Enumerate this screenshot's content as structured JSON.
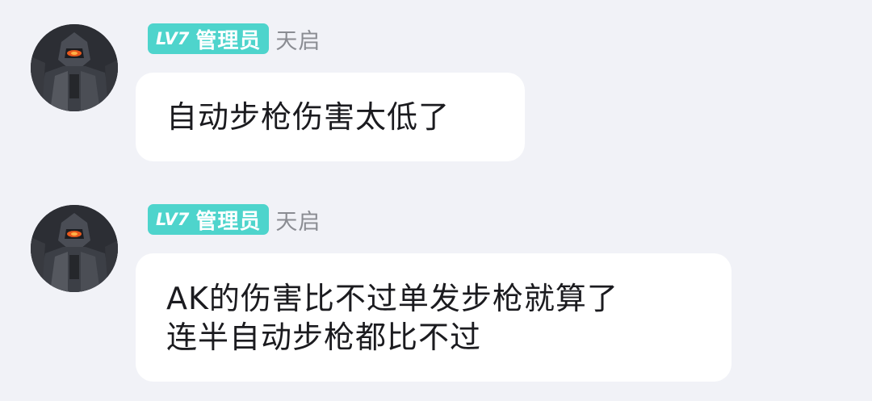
{
  "messages": [
    {
      "level": "LV7",
      "role": "管理员",
      "username": "天启",
      "lines": [
        "自动步枪伤害太低了"
      ]
    },
    {
      "level": "LV7",
      "role": "管理员",
      "username": "天启",
      "lines": [
        "AK的伤害比不过单发步枪就算了",
        "连半自动步枪都比不过"
      ]
    }
  ],
  "colors": {
    "background": "#f1f2f7",
    "badge": "#4ed4cc",
    "bubble": "#ffffff",
    "username": "#8a8c92"
  }
}
